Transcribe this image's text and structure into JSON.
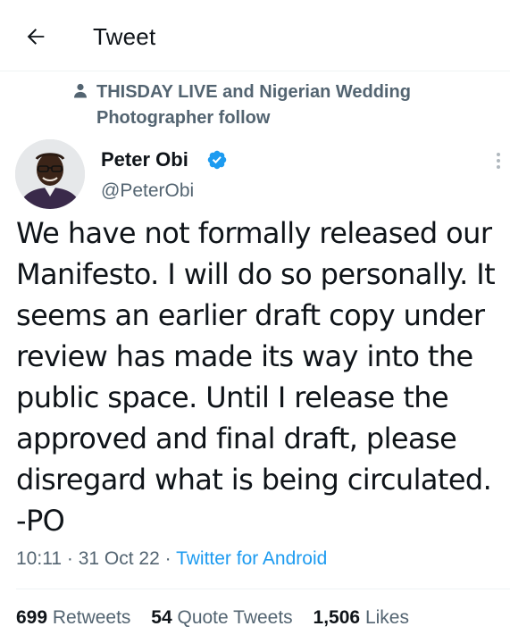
{
  "header": {
    "back_icon": "arrow-left-icon",
    "title": "Tweet"
  },
  "social_context": {
    "icon": "person-icon",
    "text": "THISDAY LIVE and Nigerian Wedding Photographer follow"
  },
  "author": {
    "name": "Peter Obi",
    "handle": "@PeterObi",
    "verified": true,
    "verified_color": "#1d9bf0"
  },
  "tweet": {
    "text": "We have not formally released our Manifesto. I will do so personally. It seems an earlier draft copy under review has made its way into the public space. Until I release the approved and final draft, please disregard what is being circulated. -PO",
    "time": "10:11",
    "separator": "·",
    "date": "31 Oct 22",
    "source": "Twitter for Android"
  },
  "stats": {
    "retweets": {
      "count": "699",
      "label": "Retweets"
    },
    "quote_tweets": {
      "count": "54",
      "label": "Quote Tweets"
    },
    "likes": {
      "count": "1,506",
      "label": "Likes"
    }
  },
  "colors": {
    "accent": "#1d9bf0",
    "secondary_text": "#536471",
    "primary_text": "#0f1419"
  }
}
